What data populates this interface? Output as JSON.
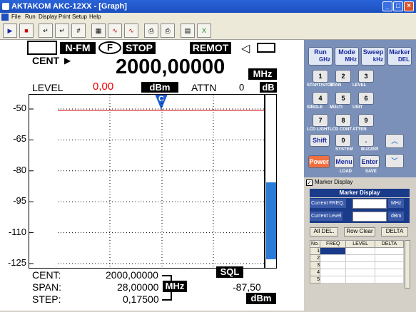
{
  "window": {
    "title": "AKTAKOM AKC-12XX - [Graph]"
  },
  "menu": [
    "File",
    "Run",
    "Display",
    "Print",
    "Setup",
    "Help"
  ],
  "display": {
    "status_box_empty": "",
    "mode": "N-FM",
    "filter": "F",
    "state": "STOP",
    "remote": "REMOT",
    "cent_label": "CENT",
    "freq_value": "2000,00000",
    "freq_unit": "MHz",
    "level_label": "LEVEL",
    "level_value": "0,00",
    "level_unit": "dBm",
    "attn_label": "ATTN",
    "attn_value": "0",
    "attn_unit": "dB",
    "marker_label": "C",
    "cent_footer_label": "CENT:",
    "cent_footer_value": "2000,00000",
    "span_label": "SPAN:",
    "span_value": "28,00000",
    "step_label": "STEP:",
    "step_value": "0,17500",
    "footer_unit": "MHz",
    "sql_label": "SQL",
    "sql_value": "-87,50",
    "sql_unit": "dBm"
  },
  "chart_data": {
    "type": "line",
    "y_ticks": [
      "-50",
      "-65",
      "-80",
      "-95",
      "-110",
      "-125"
    ],
    "ylim": [
      -125,
      -50
    ],
    "reference_line": -50,
    "sql_bar_level": 0.44
  },
  "keypad": {
    "top": [
      {
        "l1": "Run",
        "l2": "GHz"
      },
      {
        "l1": "Mode",
        "l2": "MHz"
      },
      {
        "l1": "Sweep",
        "l2": "kHz"
      },
      {
        "l1": "Marker",
        "l2": "DEL"
      }
    ],
    "rows": [
      {
        "keys": [
          "1",
          "2",
          "3"
        ],
        "caps": [
          "START/STOP",
          "SPAN",
          "LEVEL"
        ]
      },
      {
        "keys": [
          "4",
          "5",
          "6"
        ],
        "caps": [
          "SINGLE",
          "MULTI",
          "UNIT"
        ]
      },
      {
        "keys": [
          "7",
          "8",
          "9"
        ],
        "caps": [
          "LCD LIGHT",
          "LCD CONT",
          "ATTEN"
        ]
      }
    ],
    "shift": "Shift",
    "zero": "0",
    "dot": ".",
    "system": "SYSTEM",
    "buzzer": "BUZZER",
    "power": "Power",
    "menu": "Menu",
    "enter": "Enter",
    "load": "LOAD",
    "save": "SAVE"
  },
  "marker_display": {
    "checkbox_label": "Marker Display",
    "header": "Marker Display",
    "current_freq": "Current FREQ.",
    "freq_unit": "MHz",
    "current_level": "Current Level",
    "level_unit": "dBm",
    "all_del": "All DEL.",
    "row_clear": "Row Clear",
    "delta": "DELTA",
    "cols": [
      "No.",
      "FREQ",
      "LEVEL",
      "DELTA"
    ],
    "rows": [
      "1",
      "2",
      "3",
      "4",
      "5"
    ]
  }
}
